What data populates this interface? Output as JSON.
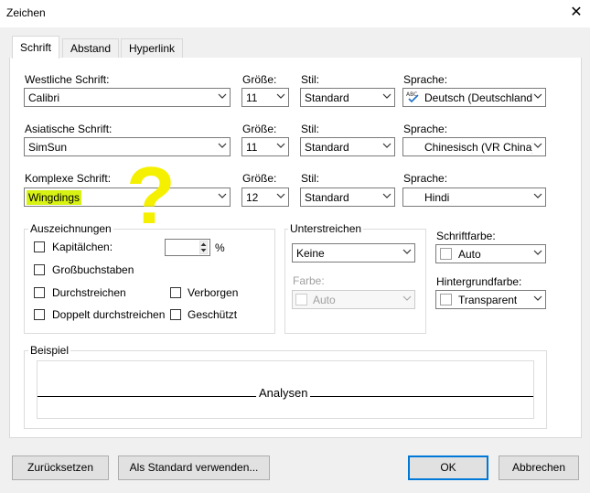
{
  "window": {
    "title": "Zeichen"
  },
  "tabs": [
    {
      "label": "Schrift",
      "active": true
    },
    {
      "label": "Abstand",
      "active": false
    },
    {
      "label": "Hyperlink",
      "active": false
    }
  ],
  "fonts": {
    "western": {
      "label": "Westliche Schrift:",
      "value": "Calibri"
    },
    "asian": {
      "label": "Asiatische Schrift:",
      "value": "SimSun"
    },
    "complex": {
      "label": "Komplexe Schrift:",
      "value": "Wingdings"
    }
  },
  "size_label": "Größe:",
  "style_label": "Stil:",
  "language_label": "Sprache:",
  "sizes": {
    "western": "11",
    "asian": "11",
    "complex": "12"
  },
  "styles": {
    "western": "Standard",
    "asian": "Standard",
    "complex": "Standard"
  },
  "languages": {
    "western": "Deutsch (Deutschland)",
    "asian": "Chinesisch (VR China)",
    "complex": "Hindi"
  },
  "effects": {
    "title": "Auszeichnungen",
    "small_caps": "Kapitälchen:",
    "small_caps_unit": "%",
    "all_caps": "Großbuchstaben",
    "strikethrough": "Durchstreichen",
    "double_strikethrough": "Doppelt durchstreichen",
    "hidden": "Verborgen",
    "protected": "Geschützt"
  },
  "underline": {
    "title": "Unterstreichen",
    "value": "Keine",
    "color_label": "Farbe:",
    "color_value": "Auto"
  },
  "font_color": {
    "label": "Schriftfarbe:",
    "value": "Auto"
  },
  "background_color": {
    "label": "Hintergrundfarbe:",
    "value": "Transparent"
  },
  "preview": {
    "title": "Beispiel",
    "text": "Analysen"
  },
  "buttons": {
    "reset": "Zurücksetzen",
    "set_default": "Als Standard verwenden...",
    "ok": "OK",
    "cancel": "Abbrechen"
  },
  "annotation": {
    "mark": "?",
    "color": "#f5f000"
  },
  "colors": {
    "accent": "#0078d7",
    "highlight": "#d7f213"
  }
}
